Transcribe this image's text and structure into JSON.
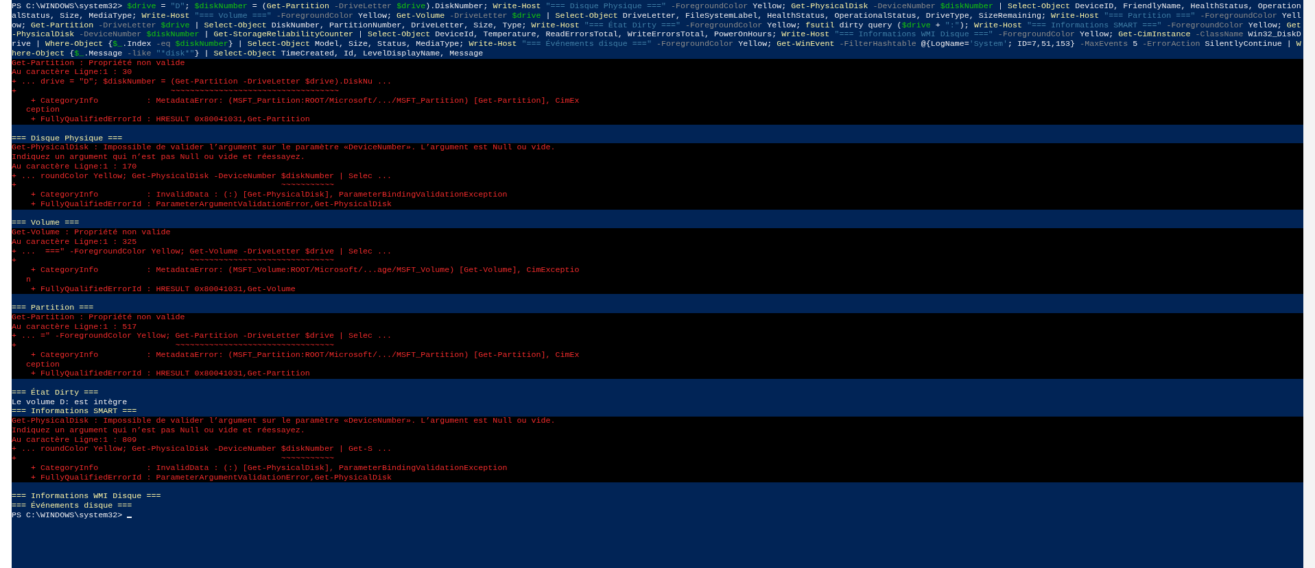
{
  "console": {
    "lines": [
      {
        "kind": "command",
        "tokens": [
          {
            "kind": "plain",
            "text": "PS C:\\WINDOWS\\system32> "
          },
          {
            "kind": "var",
            "text": "$drive"
          },
          {
            "kind": "plain",
            "text": " = "
          },
          {
            "kind": "str",
            "text": "\"D\""
          },
          {
            "kind": "plain",
            "text": "; "
          },
          {
            "kind": "var",
            "text": "$diskNumber"
          },
          {
            "kind": "plain",
            "text": " = ("
          },
          {
            "kind": "cmd",
            "text": "Get-Partition"
          },
          {
            "kind": "param",
            "text": " -DriveLetter "
          },
          {
            "kind": "var",
            "text": "$drive"
          },
          {
            "kind": "plain",
            "text": ").DiskNumber; "
          },
          {
            "kind": "cmd",
            "text": "Write-Host"
          },
          {
            "kind": "str",
            "text": " \"=== Disque Physique ===\""
          },
          {
            "kind": "param",
            "text": " -ForegroundColor"
          },
          {
            "kind": "plain",
            "text": " Yellow; "
          },
          {
            "kind": "cmd",
            "text": "Get-PhysicalDisk"
          },
          {
            "kind": "param",
            "text": " -DeviceNumber "
          },
          {
            "kind": "var",
            "text": "$diskNumber"
          },
          {
            "kind": "plain",
            "text": " | "
          },
          {
            "kind": "cmd",
            "text": "Select-Object"
          },
          {
            "kind": "plain",
            "text": " DeviceID, FriendlyName, HealthStatus, Operation"
          }
        ]
      },
      {
        "kind": "command",
        "tokens": [
          {
            "kind": "plain",
            "text": "alStatus, Size, MediaType; "
          },
          {
            "kind": "cmd",
            "text": "Write-Host"
          },
          {
            "kind": "str",
            "text": " \"=== Volume ===\""
          },
          {
            "kind": "param",
            "text": " -ForegroundColor"
          },
          {
            "kind": "plain",
            "text": " Yellow; "
          },
          {
            "kind": "cmd",
            "text": "Get-Volume"
          },
          {
            "kind": "param",
            "text": " -DriveLetter "
          },
          {
            "kind": "var",
            "text": "$drive"
          },
          {
            "kind": "plain",
            "text": " | "
          },
          {
            "kind": "cmd",
            "text": "Select-Object"
          },
          {
            "kind": "plain",
            "text": " DriveLetter, FileSystemLabel, HealthStatus, OperationalStatus, DriveType, SizeRemaining; "
          },
          {
            "kind": "cmd",
            "text": "Write-Host"
          },
          {
            "kind": "str",
            "text": " \"=== Partition ===\""
          },
          {
            "kind": "param",
            "text": " -ForegroundColor"
          },
          {
            "kind": "plain",
            "text": " Yell"
          }
        ]
      },
      {
        "kind": "command",
        "tokens": [
          {
            "kind": "plain",
            "text": "ow; "
          },
          {
            "kind": "cmd",
            "text": "Get-Partition"
          },
          {
            "kind": "param",
            "text": " -DriveLetter "
          },
          {
            "kind": "var",
            "text": "$drive"
          },
          {
            "kind": "plain",
            "text": " | "
          },
          {
            "kind": "cmd",
            "text": "Select-Object"
          },
          {
            "kind": "plain",
            "text": " DiskNumber, PartitionNumber, DriveLetter, Size, Type; "
          },
          {
            "kind": "cmd",
            "text": "Write-Host"
          },
          {
            "kind": "str",
            "text": " \"=== État Dirty ===\""
          },
          {
            "kind": "param",
            "text": " -ForegroundColor"
          },
          {
            "kind": "plain",
            "text": " Yellow; "
          },
          {
            "kind": "cmd",
            "text": "fsutil"
          },
          {
            "kind": "plain",
            "text": " dirty query ("
          },
          {
            "kind": "var",
            "text": "$drive"
          },
          {
            "kind": "plain",
            "text": " + "
          },
          {
            "kind": "str",
            "text": "\":\""
          },
          {
            "kind": "plain",
            "text": "); "
          },
          {
            "kind": "cmd",
            "text": "Write-Host"
          },
          {
            "kind": "str",
            "text": " \"=== Informations SMART ===\""
          },
          {
            "kind": "param",
            "text": " -ForegroundColor"
          },
          {
            "kind": "plain",
            "text": " Yellow; "
          },
          {
            "kind": "cmd",
            "text": "Get"
          }
        ]
      },
      {
        "kind": "command",
        "tokens": [
          {
            "kind": "cmd",
            "text": "-PhysicalDisk"
          },
          {
            "kind": "param",
            "text": " -DeviceNumber "
          },
          {
            "kind": "var",
            "text": "$diskNumber"
          },
          {
            "kind": "plain",
            "text": " | "
          },
          {
            "kind": "cmd",
            "text": "Get-StorageReliabilityCounter"
          },
          {
            "kind": "plain",
            "text": " | "
          },
          {
            "kind": "cmd",
            "text": "Select-Object"
          },
          {
            "kind": "plain",
            "text": " DeviceId, Temperature, ReadErrorsTotal, WriteErrorsTotal, PowerOnHours; "
          },
          {
            "kind": "cmd",
            "text": "Write-Host"
          },
          {
            "kind": "str",
            "text": " \"=== Informations WMI Disque ===\""
          },
          {
            "kind": "param",
            "text": " -ForegroundColor"
          },
          {
            "kind": "plain",
            "text": " Yellow; "
          },
          {
            "kind": "cmd",
            "text": "Get-CimInstance"
          },
          {
            "kind": "param",
            "text": " -ClassName"
          },
          {
            "kind": "plain",
            "text": " Win32_DiskD"
          }
        ]
      },
      {
        "kind": "command",
        "tokens": [
          {
            "kind": "plain",
            "text": "rive | "
          },
          {
            "kind": "cmd",
            "text": "Where-Object"
          },
          {
            "kind": "plain",
            "text": " {"
          },
          {
            "kind": "var",
            "text": "$_"
          },
          {
            "kind": "plain",
            "text": ".Index "
          },
          {
            "kind": "param",
            "text": "-eq "
          },
          {
            "kind": "var",
            "text": "$diskNumber"
          },
          {
            "kind": "plain",
            "text": "} | "
          },
          {
            "kind": "cmd",
            "text": "Select-Object"
          },
          {
            "kind": "plain",
            "text": " Model, Size, Status, MediaType; "
          },
          {
            "kind": "cmd",
            "text": "Write-Host"
          },
          {
            "kind": "str",
            "text": " \"=== Événements disque ===\""
          },
          {
            "kind": "param",
            "text": " -ForegroundColor"
          },
          {
            "kind": "plain",
            "text": " Yellow; "
          },
          {
            "kind": "cmd",
            "text": "Get-WinEvent"
          },
          {
            "kind": "param",
            "text": " -FilterHashtable"
          },
          {
            "kind": "plain",
            "text": " @{LogName="
          },
          {
            "kind": "str",
            "text": "'System'"
          },
          {
            "kind": "plain",
            "text": "; ID=7,51,153} "
          },
          {
            "kind": "param",
            "text": "-MaxEvents"
          },
          {
            "kind": "plain",
            "text": " 5 "
          },
          {
            "kind": "param",
            "text": "-ErrorAction"
          },
          {
            "kind": "plain",
            "text": " SilentlyContinue | "
          },
          {
            "kind": "cmd",
            "text": "W"
          }
        ]
      },
      {
        "kind": "command",
        "tokens": [
          {
            "kind": "cmd",
            "text": "here-Object"
          },
          {
            "kind": "plain",
            "text": " {"
          },
          {
            "kind": "var",
            "text": "$_"
          },
          {
            "kind": "plain",
            "text": ".Message "
          },
          {
            "kind": "param",
            "text": "-like "
          },
          {
            "kind": "str",
            "text": "\"*disk*\""
          },
          {
            "kind": "plain",
            "text": "} | "
          },
          {
            "kind": "cmd",
            "text": "Select-Object"
          },
          {
            "kind": "plain",
            "text": " TimeCreated, Id, LevelDisplayName, Message"
          }
        ]
      },
      {
        "kind": "error",
        "text": "Get-Partition : Propriété non valide"
      },
      {
        "kind": "error",
        "text": "Au caractère Ligne:1 : 30"
      },
      {
        "kind": "error",
        "text": "+ ... drive = \"D\"; $diskNumber = (Get-Partition -DriveLetter $drive).DiskNu ..."
      },
      {
        "kind": "error",
        "text": "+                                ~~~~~~~~~~~~~~~~~~~~~~~~~~~~~~~~~~~"
      },
      {
        "kind": "error",
        "text": "    + CategoryInfo          : MetadataError: (MSFT_Partition:ROOT/Microsoft/.../MSFT_Partition) [Get-Partition], CimEx"
      },
      {
        "kind": "error",
        "text": "   ception"
      },
      {
        "kind": "error",
        "text": "    + FullyQualifiedErrorId : HRESULT 0x80041031,Get-Partition"
      },
      {
        "kind": "blank"
      },
      {
        "kind": "heading",
        "text": "=== Disque Physique ==="
      },
      {
        "kind": "error",
        "text": "Get-PhysicalDisk : Impossible de valider l’argument sur le paramètre «DeviceNumber». L’argument est Null ou vide."
      },
      {
        "kind": "error",
        "text": "Indiquez un argument qui n’est pas Null ou vide et réessayez."
      },
      {
        "kind": "error",
        "text": "Au caractère Ligne:1 : 170"
      },
      {
        "kind": "error",
        "text": "+ ... roundColor Yellow; Get-PhysicalDisk -DeviceNumber $diskNumber | Selec ..."
      },
      {
        "kind": "error",
        "text": "+                                                       ~~~~~~~~~~~"
      },
      {
        "kind": "error",
        "text": "    + CategoryInfo          : InvalidData : (:) [Get-PhysicalDisk], ParameterBindingValidationException"
      },
      {
        "kind": "error",
        "text": "    + FullyQualifiedErrorId : ParameterArgumentValidationError,Get-PhysicalDisk"
      },
      {
        "kind": "blank"
      },
      {
        "kind": "heading",
        "text": "=== Volume ==="
      },
      {
        "kind": "error",
        "text": "Get-Volume : Propriété non valide"
      },
      {
        "kind": "error",
        "text": "Au caractère Ligne:1 : 325"
      },
      {
        "kind": "error",
        "text": "+ ...  ===\" -ForegroundColor Yellow; Get-Volume -DriveLetter $drive | Selec ..."
      },
      {
        "kind": "error",
        "text": "+                                    ~~~~~~~~~~~~~~~~~~~~~~~~~~~~~~"
      },
      {
        "kind": "error",
        "text": "    + CategoryInfo          : MetadataError: (MSFT_Volume:ROOT/Microsoft/...age/MSFT_Volume) [Get-Volume], CimExceptio"
      },
      {
        "kind": "error",
        "text": "   n"
      },
      {
        "kind": "error",
        "text": "    + FullyQualifiedErrorId : HRESULT 0x80041031,Get-Volume"
      },
      {
        "kind": "blank"
      },
      {
        "kind": "heading",
        "text": "=== Partition ==="
      },
      {
        "kind": "error",
        "text": "Get-Partition : Propriété non valide"
      },
      {
        "kind": "error",
        "text": "Au caractère Ligne:1 : 517"
      },
      {
        "kind": "error",
        "text": "+ ... =\" -ForegroundColor Yellow; Get-Partition -DriveLetter $drive | Selec ..."
      },
      {
        "kind": "error",
        "text": "+                                 ~~~~~~~~~~~~~~~~~~~~~~~~~~~~~~~~~"
      },
      {
        "kind": "error",
        "text": "    + CategoryInfo          : MetadataError: (MSFT_Partition:ROOT/Microsoft/.../MSFT_Partition) [Get-Partition], CimEx"
      },
      {
        "kind": "error",
        "text": "   ception"
      },
      {
        "kind": "error",
        "text": "    + FullyQualifiedErrorId : HRESULT 0x80041031,Get-Partition"
      },
      {
        "kind": "blank"
      },
      {
        "kind": "heading",
        "text": "=== État Dirty ==="
      },
      {
        "kind": "output",
        "text": "Le volume D: est intègre"
      },
      {
        "kind": "heading",
        "text": "=== Informations SMART ==="
      },
      {
        "kind": "error",
        "text": "Get-PhysicalDisk : Impossible de valider l’argument sur le paramètre «DeviceNumber». L’argument est Null ou vide."
      },
      {
        "kind": "error",
        "text": "Indiquez un argument qui n’est pas Null ou vide et réessayez."
      },
      {
        "kind": "error",
        "text": "Au caractère Ligne:1 : 809"
      },
      {
        "kind": "error",
        "text": "+ ... roundColor Yellow; Get-PhysicalDisk -DeviceNumber $diskNumber | Get-S ..."
      },
      {
        "kind": "error",
        "text": "+                                                       ~~~~~~~~~~~"
      },
      {
        "kind": "error",
        "text": "    + CategoryInfo          : InvalidData : (:) [Get-PhysicalDisk], ParameterBindingValidationException"
      },
      {
        "kind": "error",
        "text": "    + FullyQualifiedErrorId : ParameterArgumentValidationError,Get-PhysicalDisk"
      },
      {
        "kind": "blank"
      },
      {
        "kind": "heading",
        "text": "=== Informations WMI Disque ==="
      },
      {
        "kind": "heading",
        "text": "=== Événements disque ==="
      },
      {
        "kind": "prompt",
        "text": "PS C:\\WINDOWS\\system32> "
      }
    ]
  }
}
